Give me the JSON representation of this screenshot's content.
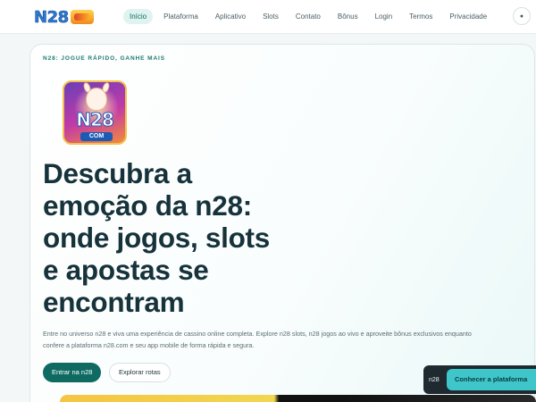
{
  "brand": {
    "logo_text": "N28"
  },
  "nav": {
    "items": [
      {
        "label": "Início"
      },
      {
        "label": "Plataforma"
      },
      {
        "label": "Aplicativo"
      },
      {
        "label": "Slots"
      },
      {
        "label": "Contato"
      },
      {
        "label": "Bônus"
      },
      {
        "label": "Login"
      },
      {
        "label": "Termos"
      },
      {
        "label": "Privacidade"
      }
    ],
    "active_index": 0
  },
  "hero": {
    "eyebrow": "N28: JOGUE RÁPIDO, GANHE MAIS",
    "app_icon_text": "N28",
    "app_icon_sub": "COM",
    "headline_lines": [
      "Descubra a",
      "emoção da n28:",
      "onde jogos, slots",
      "e apostas se",
      "encontram"
    ],
    "description": "Entre no universo n28 e viva uma experiência de cassino online completa. Explore n28 slots, n28 jogos ao vivo e aproveite bônus exclusivos enquanto confere a plataforma n28.com e seu app mobile de forma rápida e segura.",
    "primary_cta": "Entrar na n28",
    "secondary_cta": "Explorar rotas"
  },
  "floating_cta": {
    "tag": "n28",
    "label": "Conhecer a plataforma"
  },
  "colors": {
    "accent": "#0f6b62",
    "cta_float": "#3fc6cb",
    "headline": "#16323a"
  }
}
